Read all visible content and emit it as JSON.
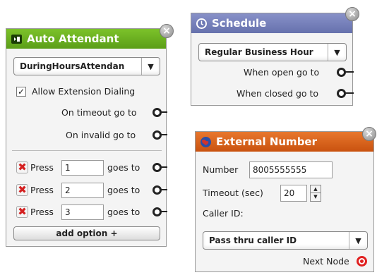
{
  "auto_attendant": {
    "title": "Auto Attendant",
    "header_color": "#62a61a",
    "close_label": "×",
    "dropdown_value": "DuringHoursAttendan",
    "dropdown_arrow": "▼",
    "check_mark": "✓",
    "allow_extension_label": "Allow Extension Dialing",
    "allow_extension_checked": true,
    "on_timeout_label": "On timeout go to",
    "on_invalid_label": "On invalid go to",
    "options": [
      {
        "press_label": "Press",
        "digit": "1",
        "goes_to_label": "goes to"
      },
      {
        "press_label": "Press",
        "digit": "2",
        "goes_to_label": "goes to"
      },
      {
        "press_label": "Press",
        "digit": "3",
        "goes_to_label": "goes to"
      }
    ],
    "remove_icon": "✖",
    "add_option_label": "add option +"
  },
  "schedule": {
    "title": "Schedule",
    "header_color": "#6f7ab6",
    "close_label": "×",
    "dropdown_value": "Regular Business Hour",
    "dropdown_arrow": "▼",
    "when_open_label": "When open go to",
    "when_closed_label": "When closed go to"
  },
  "external_number": {
    "title": "External Number",
    "header_color": "#d9631a",
    "close_label": "×",
    "number_label": "Number",
    "number_value": "8005555555",
    "timeout_label": "Timeout (sec)",
    "timeout_value": "20",
    "spinner_up": "▲",
    "spinner_down": "▼",
    "caller_id_label": "Caller ID:",
    "caller_id_value": "Pass thru caller ID",
    "dropdown_arrow": "▼",
    "next_node_label": "Next Node",
    "next_node_color": "#e02020"
  }
}
